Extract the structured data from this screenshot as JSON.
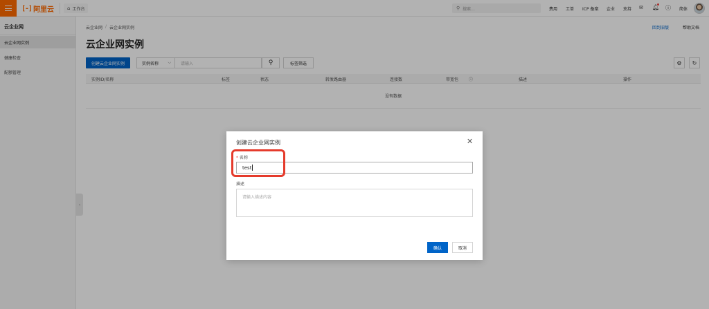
{
  "topbar": {
    "logo_text": "阿里云",
    "logo_mark": "[-]",
    "workbench_label": "工作台",
    "search_placeholder": "搜索...",
    "nav": [
      "费用",
      "工单",
      "ICP 备案",
      "企业",
      "支持",
      "简体"
    ]
  },
  "sidebar": {
    "title": "云企业网",
    "items": [
      {
        "label": "云企业网实例",
        "active": true
      },
      {
        "label": "健康检查",
        "active": false
      },
      {
        "label": "配额管理",
        "active": false
      }
    ]
  },
  "breadcrumb": [
    "云企业网",
    "云企业网实例"
  ],
  "top_links": {
    "back_old": "回到旧版",
    "help": "帮助文档"
  },
  "page": {
    "title": "云企业网实例"
  },
  "toolbar": {
    "create_label": "创建云企业网实例",
    "filter_field": "实例名称",
    "filter_placeholder": "请输入",
    "tag_filter_label": "标签筛选"
  },
  "table": {
    "columns": [
      "实例ID/名称",
      "标签",
      "状态",
      "转发路由器",
      "连接数",
      "带宽包",
      "描述",
      "操作"
    ],
    "empty_text": "没有数据"
  },
  "dialog": {
    "title": "创建云企业网实例",
    "name_label": "名称",
    "name_value": "test",
    "desc_label": "描述",
    "desc_placeholder": "请输入描述内容",
    "confirm_label": "确认",
    "cancel_label": "取消"
  },
  "colors": {
    "primary": "#0064c8",
    "brand": "#ff6a00",
    "highlight": "#e53b2c"
  }
}
